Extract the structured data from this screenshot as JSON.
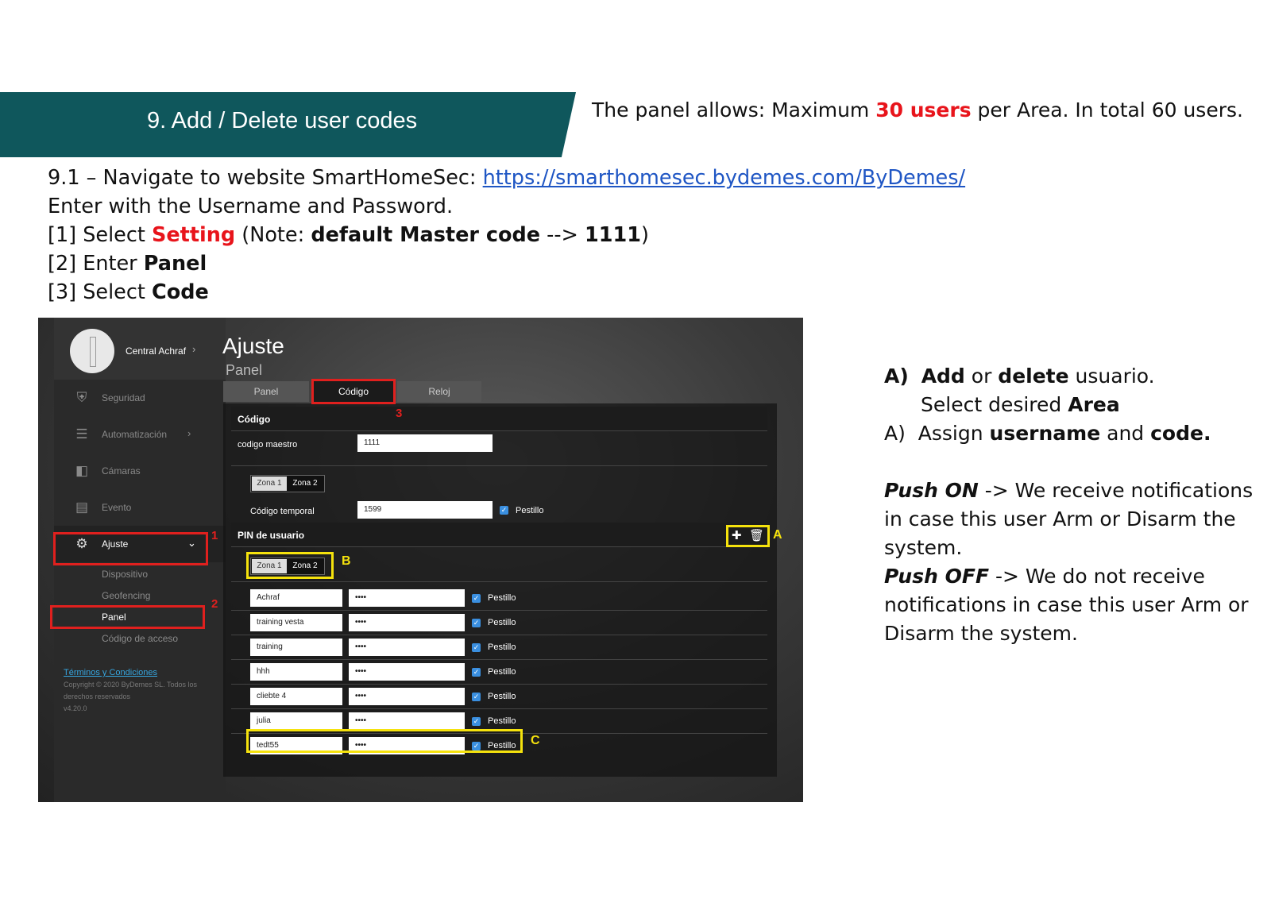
{
  "header": {
    "title": "9. Add / Delete user codes",
    "note_prefix": "The panel allows: Maximum ",
    "note_highlight": "30 users",
    "note_suffix": " per Area. In total 60 users."
  },
  "instructions": {
    "l1_prefix": "9.1 – Navigate to website SmartHomeSec: ",
    "l1_link": "https://smarthomesec.bydemes.com/ByDemes/",
    "l2": "Enter with the Username and Password.",
    "l3_a": "[1] Select ",
    "l3_red": "Setting",
    "l3_b": " (Note: ",
    "l3_bold": "default Master code",
    "l3_c": " --> ",
    "l3_code": "1111",
    "l3_d": ")",
    "l4_a": "[2] Enter ",
    "l4_bold": "Panel",
    "l5_a": "[3] Select ",
    "l5_bold": "Code"
  },
  "app": {
    "device_name": "Central Achraf",
    "nav": [
      {
        "label": "Seguridad",
        "icon": "shield-icon"
      },
      {
        "label": "Automatización",
        "icon": "sliders-icon"
      },
      {
        "label": "Cámaras",
        "icon": "camera-icon"
      },
      {
        "label": "Evento",
        "icon": "list-icon"
      },
      {
        "label": "Ajuste",
        "icon": "gear-icon"
      }
    ],
    "subnav": [
      "Dispositivo",
      "Geofencing",
      "Panel",
      "Código de acceso"
    ],
    "footer": {
      "terms": "Términos y Condiciones",
      "copyright": "Copyright © 2020 ByDemes SL. Todos los derechos reservados",
      "version": "v4.20.0"
    },
    "page_title": "Ajuste",
    "page_subtitle": "Panel",
    "tabs": [
      "Panel",
      "Código",
      "Reloj"
    ],
    "codigo_section": "Código",
    "master_label": "codigo maestro",
    "master_value": "1111",
    "zones": [
      "Zona 1",
      "Zona 2"
    ],
    "temp_label": "Código temporal",
    "temp_value": "1599",
    "pestillo": "Pestillo",
    "pin_section": "PIN de usuario",
    "users": [
      {
        "name": "Achraf",
        "code": "••••"
      },
      {
        "name": "training vesta",
        "code": "••••"
      },
      {
        "name": "training",
        "code": "••••"
      },
      {
        "name": "hhh",
        "code": "••••"
      },
      {
        "name": "cliebte 4",
        "code": "••••"
      },
      {
        "name": "julia",
        "code": "••••"
      },
      {
        "name": "tedt55",
        "code": "••••"
      }
    ]
  },
  "annotations": {
    "red_numbers": [
      "1",
      "2",
      "3"
    ],
    "yellow_letters": [
      "A",
      "B",
      "C"
    ],
    "colors": {
      "red": "#e0201e",
      "yellow": "#f5e20d",
      "band": "#0f575c"
    }
  },
  "notes": {
    "a1_label": "A)",
    "a1_bold1": "Add",
    "a1_mid": " or ",
    "a1_bold2": "delete",
    "a1_end": " usuario.",
    "a1_line2_a": "Select desired ",
    "a1_line2_bold": "Area",
    "a2_label": "A)",
    "a2_a": "Assign ",
    "a2_bold1": "username",
    "a2_mid": " and ",
    "a2_bold2": "code.",
    "push_on": "Push ON",
    "push_on_text1": " -> We receive notifications",
    "push_on_text2": "in case this user Arm or Disarm the",
    "push_on_text3": "system.",
    "push_off": "Push OFF",
    "push_off_text1": " -> We do not receive",
    "push_off_text2": "notifications in case this user Arm or",
    "push_off_text3": "Disarm the system."
  }
}
